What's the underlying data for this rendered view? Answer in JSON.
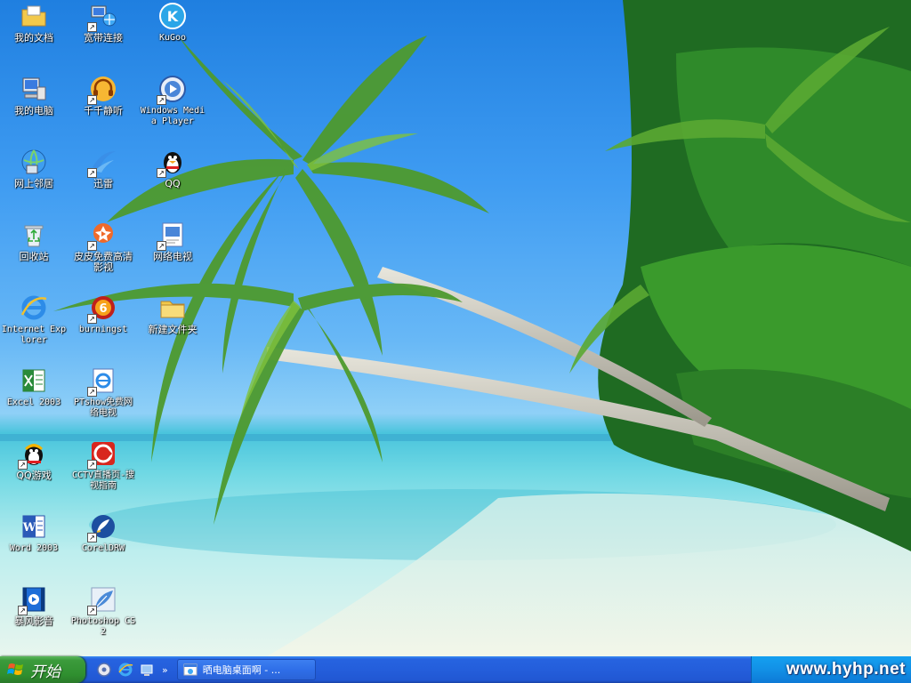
{
  "desktop": {
    "icons": [
      {
        "id": "my-documents",
        "label": "我的文档",
        "icon": "folder-documents-icon",
        "shortcut": false
      },
      {
        "id": "broadband",
        "label": "宽带连接",
        "icon": "network-connection-icon",
        "shortcut": true
      },
      {
        "id": "kugoo",
        "label": "KuGoo",
        "icon": "kugoo-icon",
        "shortcut": false
      },
      {
        "id": "my-computer",
        "label": "我的电脑",
        "icon": "computer-icon",
        "shortcut": false
      },
      {
        "id": "qianqian",
        "label": "千千静听",
        "icon": "headphones-icon",
        "shortcut": true
      },
      {
        "id": "wmp",
        "label": "Windows Media Player",
        "icon": "media-player-icon",
        "shortcut": true
      },
      {
        "id": "network-places",
        "label": "网上邻居",
        "icon": "network-places-icon",
        "shortcut": false
      },
      {
        "id": "xunlei",
        "label": "迅雷",
        "icon": "xunlei-icon",
        "shortcut": true
      },
      {
        "id": "qq",
        "label": "QQ",
        "icon": "qq-penguin-icon",
        "shortcut": true
      },
      {
        "id": "recycle-bin",
        "label": "回收站",
        "icon": "recycle-bin-icon",
        "shortcut": false
      },
      {
        "id": "pipi",
        "label": "皮皮免费高清影视",
        "icon": "pipi-video-icon",
        "shortcut": true
      },
      {
        "id": "net-tv",
        "label": "网络电视",
        "icon": "tv-icon",
        "shortcut": true
      },
      {
        "id": "ie",
        "label": "Internet Explorer",
        "icon": "internet-explorer-icon",
        "shortcut": false
      },
      {
        "id": "burning",
        "label": "burningst",
        "icon": "burning-icon",
        "shortcut": true
      },
      {
        "id": "new-folder",
        "label": "新建文件夹",
        "icon": "folder-icon",
        "shortcut": false
      },
      {
        "id": "excel",
        "label": "Excel 2003",
        "icon": "excel-icon",
        "shortcut": false
      },
      {
        "id": "ptshow",
        "label": "PTshow免费网络电视",
        "icon": "ptshow-icon",
        "shortcut": true
      },
      {
        "id": "qq-game",
        "label": "QQ游戏",
        "icon": "qq-game-icon",
        "shortcut": true
      },
      {
        "id": "cctv",
        "label": "CCTV直播页-搜视指南",
        "icon": "cctv-icon",
        "shortcut": true
      },
      {
        "id": "word",
        "label": "Word 2003",
        "icon": "word-icon",
        "shortcut": false
      },
      {
        "id": "coreldraw",
        "label": "CorelDRW",
        "icon": "coreldraw-icon",
        "shortcut": true
      },
      {
        "id": "baofeng",
        "label": "暴风影音",
        "icon": "baofeng-icon",
        "shortcut": true
      },
      {
        "id": "photoshop",
        "label": "Photoshop CS2",
        "icon": "photoshop-feather-icon",
        "shortcut": true
      }
    ]
  },
  "taskbar": {
    "start_label": "开始",
    "quick_launch": [
      "media-icon",
      "internet-explorer-icon",
      "show-desktop-icon"
    ],
    "quick_launch_more": "»",
    "task_title": "晒电脑桌面啊 - ...",
    "watermark": "www.hyhp.net"
  },
  "colors": {
    "taskbar": "#245edb",
    "start_button": "#3c9b3c",
    "tray": "#1290e6",
    "sky": "#3f9cf2",
    "sea": "#6fd8e4",
    "sand": "#e8f6ee"
  }
}
